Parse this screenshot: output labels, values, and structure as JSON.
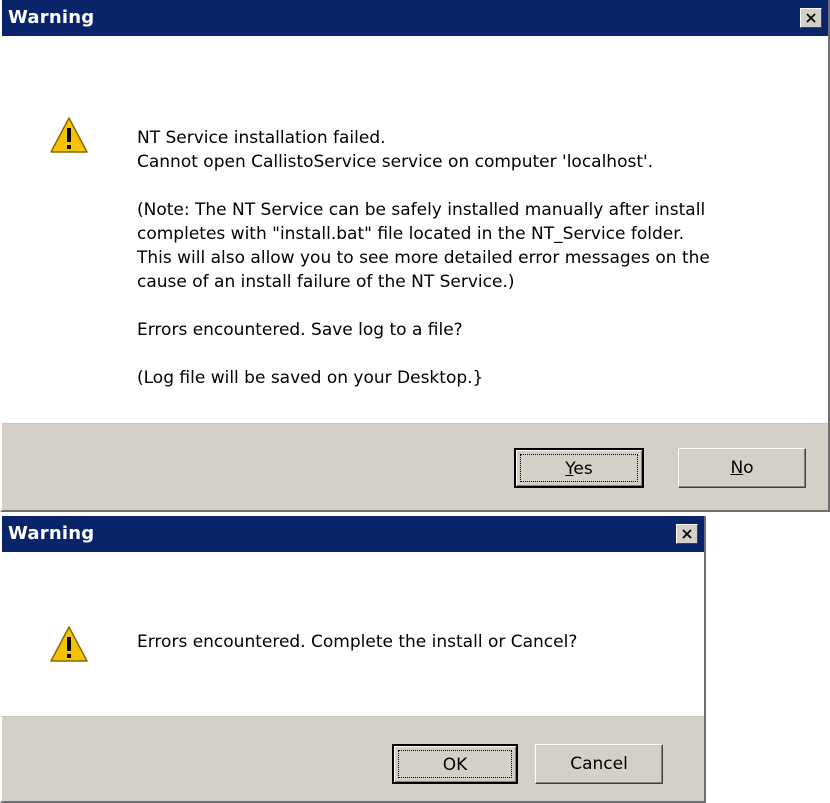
{
  "dialogs": [
    {
      "title": "Warning",
      "icon": "warning-triangle-icon",
      "message": [
        [
          "NT Service installation failed.",
          "Cannot open CallistoService service on computer 'localhost'."
        ],
        [
          "(Note: The NT Service can be safely installed manually after install",
          "completes with \"install.bat\" file located in the NT_Service folder.",
          "This will also allow you to see more detailed error messages on the",
          "cause of an install failure of the NT Service.)"
        ],
        [
          "Errors encountered.  Save log to a file?"
        ],
        [
          "(Log file will be saved on your Desktop.}"
        ]
      ],
      "buttons": {
        "yes": {
          "mnemonic": "Y",
          "rest": "es"
        },
        "no": {
          "mnemonic": "N",
          "rest": "o"
        }
      }
    },
    {
      "title": "Warning",
      "icon": "warning-triangle-icon",
      "message": [
        [
          "Errors encountered.  Complete the install or Cancel?"
        ]
      ],
      "buttons": {
        "ok": "OK",
        "cancel": "Cancel"
      }
    }
  ],
  "colors": {
    "titlebar": "#0a246a",
    "button_face": "#d4d0c8",
    "warning_yellow": "#f5c400"
  }
}
